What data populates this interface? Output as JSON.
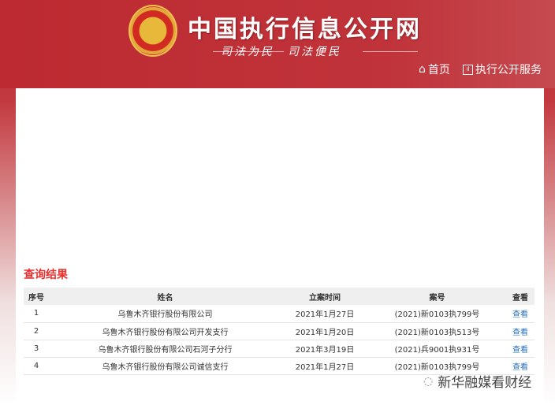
{
  "header": {
    "title": "中国执行信息公开网",
    "slogan": "司法为民　司法便民",
    "nav": [
      {
        "label": "首页",
        "icon": "home-icon"
      },
      {
        "label": "执行公开服务",
        "icon": "chart-icon"
      }
    ]
  },
  "results": {
    "title": "查询结果",
    "columns": [
      "序号",
      "姓名",
      "立案时间",
      "案号",
      "查看"
    ],
    "rows": [
      {
        "no": "1",
        "name": "乌鲁木齐银行股份有限公司",
        "date": "2021年1月27日",
        "case": "(2021)新0103执799号",
        "view": "查看"
      },
      {
        "no": "2",
        "name": "乌鲁木齐银行股份有限公司开发支行",
        "date": "2021年1月20日",
        "case": "(2021)新0103执513号",
        "view": "查看"
      },
      {
        "no": "3",
        "name": "乌鲁木齐银行股份有限公司石河子分行",
        "date": "2021年3月19日",
        "case": "(2021)兵9001执931号",
        "view": "查看"
      },
      {
        "no": "4",
        "name": "乌鲁木齐银行股份有限公司诚信支行",
        "date": "2021年1月27日",
        "case": "(2021)新0103执799号",
        "view": "查看"
      }
    ]
  },
  "watermark": "新华融媒看财经"
}
